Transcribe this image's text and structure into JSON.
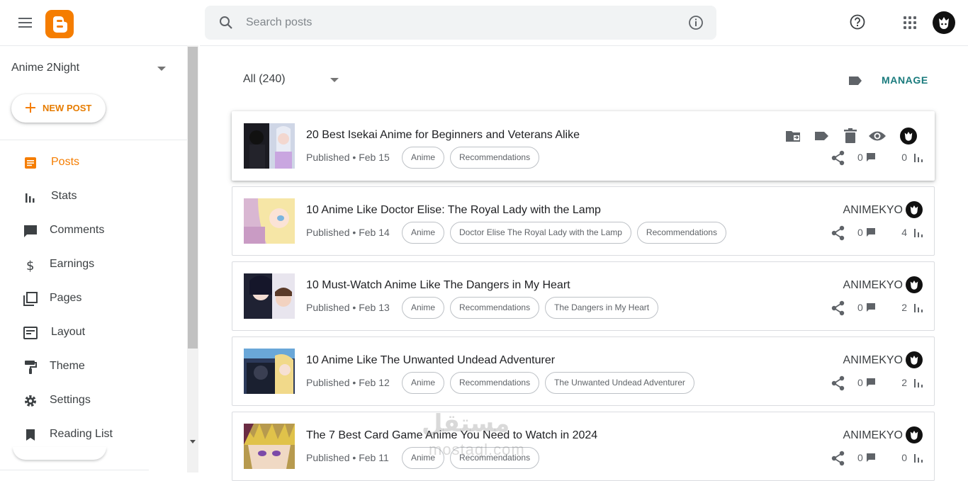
{
  "header": {
    "search_placeholder": "Search posts",
    "icons": [
      "menu-icon",
      "blogger-logo",
      "search-icon",
      "info-icon",
      "help-icon",
      "apps-grid-icon",
      "account-avatar"
    ]
  },
  "sidebar": {
    "blog_name": "Anime 2Night",
    "new_post_label": "NEW POST",
    "items": [
      {
        "label": "Posts",
        "icon": "posts-icon",
        "active": true
      },
      {
        "label": "Stats",
        "icon": "stats-icon"
      },
      {
        "label": "Comments",
        "icon": "comments-icon"
      },
      {
        "label": "Earnings",
        "icon": "dollar-icon"
      },
      {
        "label": "Pages",
        "icon": "pages-icon"
      },
      {
        "label": "Layout",
        "icon": "layout-icon"
      },
      {
        "label": "Theme",
        "icon": "paint-roller-icon"
      },
      {
        "label": "Settings",
        "icon": "gear-icon"
      },
      {
        "label": "Reading List",
        "icon": "bookmark-icon"
      }
    ]
  },
  "main": {
    "filter_label": "All (240)",
    "manage_label": "MANAGE",
    "posts": [
      {
        "title": "20 Best Isekai Anime for Beginners and Veterans Alike",
        "status": "Published",
        "date": "Feb 15",
        "labels": [
          "Anime",
          "Recommendations"
        ],
        "author": "",
        "shares": "",
        "comments": "0",
        "views": "0"
      },
      {
        "title": "10 Anime Like Doctor Elise: The Royal Lady with the Lamp",
        "status": "Published",
        "date": "Feb 14",
        "labels": [
          "Anime",
          "Doctor Elise The Royal Lady with the Lamp",
          "Recommendations"
        ],
        "author": "ANIMEKYO",
        "comments": "0",
        "views": "4"
      },
      {
        "title": "10 Must-Watch Anime Like The Dangers in My Heart",
        "status": "Published",
        "date": "Feb 13",
        "labels": [
          "Anime",
          "Recommendations",
          "The Dangers in My Heart"
        ],
        "author": "ANIMEKYO",
        "comments": "0",
        "views": "2"
      },
      {
        "title": "10 Anime Like The Unwanted Undead Adventurer",
        "status": "Published",
        "date": "Feb 12",
        "labels": [
          "Anime",
          "Recommendations",
          "The Unwanted Undead Adventurer"
        ],
        "author": "ANIMEKYO",
        "comments": "0",
        "views": "2"
      },
      {
        "title": "The 7 Best Card Game Anime You Need to Watch in 2024",
        "status": "Published",
        "date": "Feb 11",
        "labels": [
          "Anime",
          "Recommendations"
        ],
        "author": "ANIMEKYO",
        "comments": "0",
        "views": "0"
      }
    ]
  },
  "watermark": {
    "arabic": "مستقل",
    "latin": "mostaql.com"
  },
  "colors": {
    "accent": "#f57d00",
    "manage": "#1a7b7d",
    "text": "#202124",
    "muted": "#5f6368"
  }
}
